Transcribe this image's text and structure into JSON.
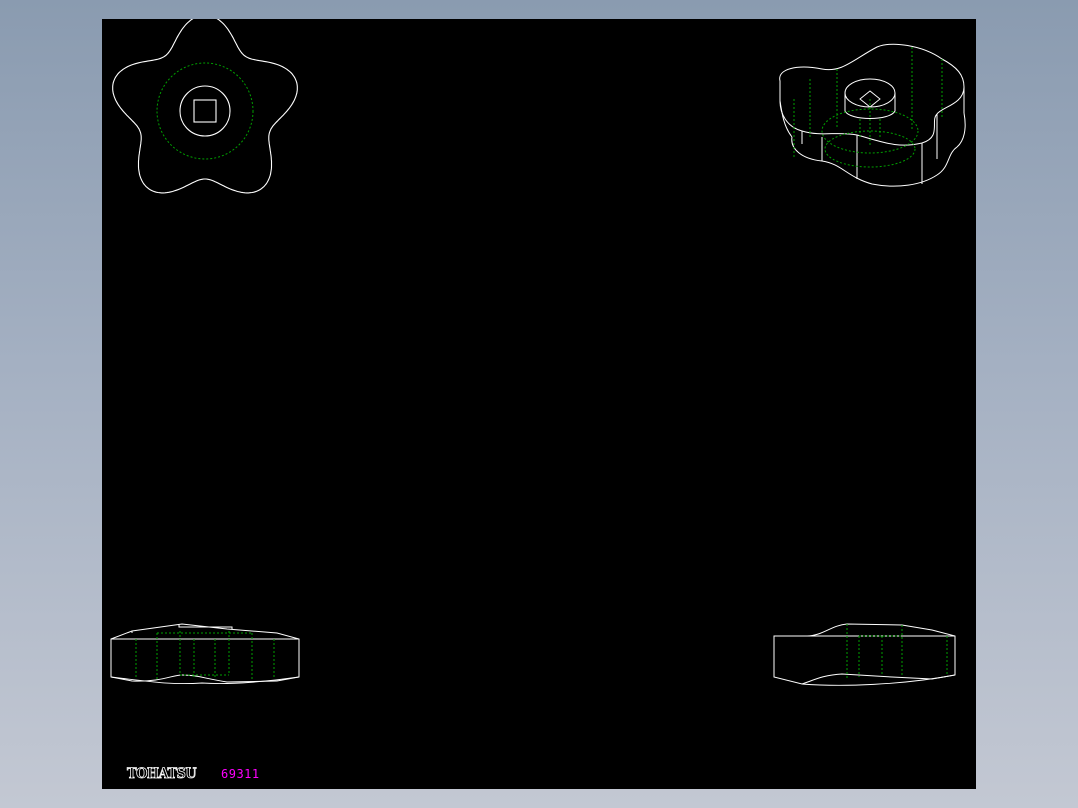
{
  "drawing": {
    "background_color": "#000000",
    "outline_color": "#ffffff",
    "hidden_line_color": "#00a000",
    "views": [
      {
        "name": "top-view"
      },
      {
        "name": "isometric-view"
      },
      {
        "name": "front-view"
      },
      {
        "name": "side-view"
      }
    ]
  },
  "title_block": {
    "brand": "TOHATSU",
    "part_number": "69311",
    "part_number_color": "#ff00ff"
  }
}
